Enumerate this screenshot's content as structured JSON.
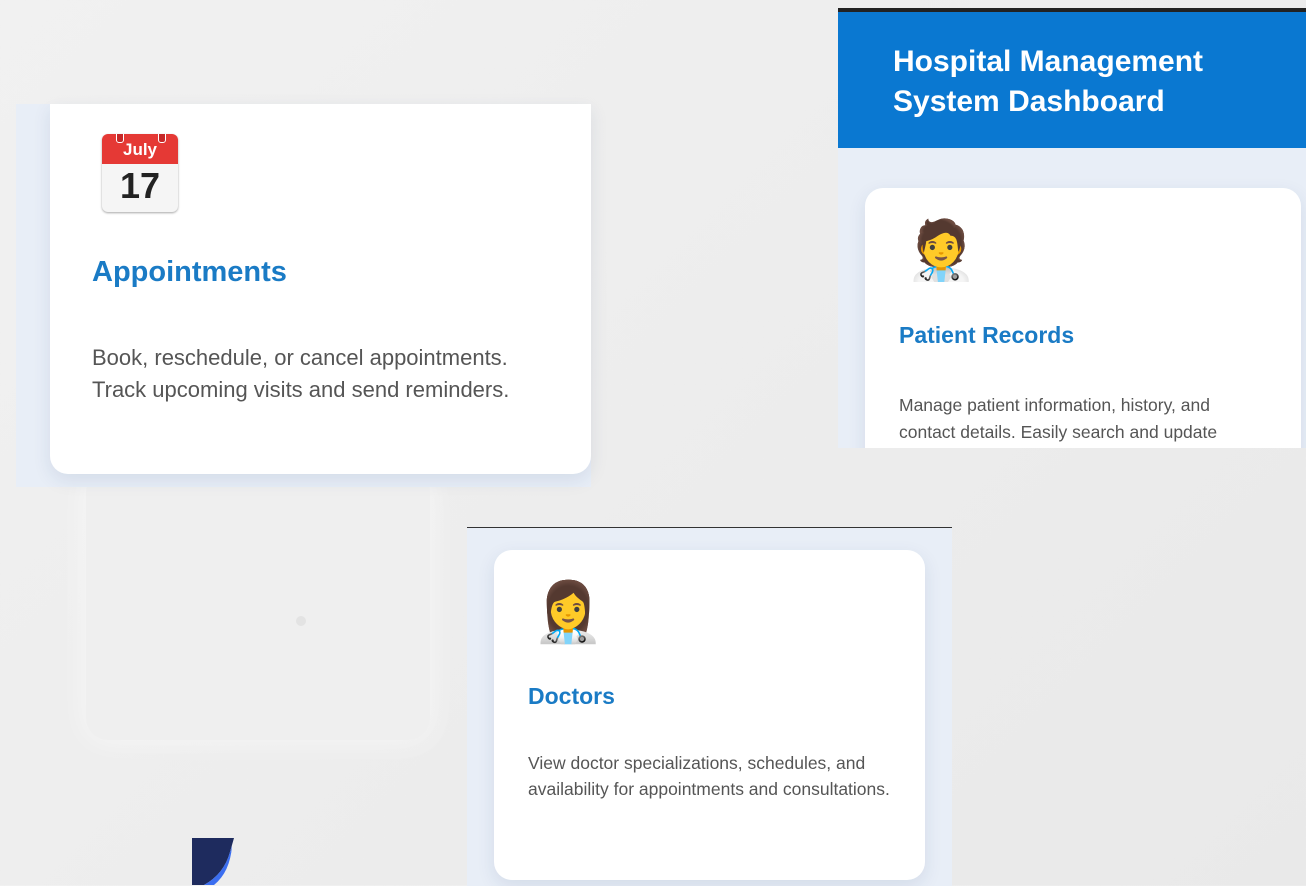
{
  "dashboard": {
    "title": "Hospital Management System Dashboard"
  },
  "cards": {
    "appointments": {
      "icon": "calendar-icon",
      "calendar_month": "July",
      "calendar_day": "17",
      "title": "Appointments",
      "description": "Book, reschedule, or cancel appointments. Track upcoming visits and send reminders."
    },
    "patient_records": {
      "icon": "health-worker-icon",
      "emoji": "🧑‍⚕️",
      "title": "Patient Records",
      "description": "Manage patient information, history, and contact details. Easily search and update"
    },
    "doctors": {
      "icon": "woman-health-worker-icon",
      "emoji": "👩‍⚕️",
      "title": "Doctors",
      "description": "View doctor specializations, schedules, and availability for appointments and consultations."
    }
  },
  "colors": {
    "header_blue": "#0a78d1",
    "title_blue": "#1a7bc5",
    "calendar_red": "#e53935"
  }
}
